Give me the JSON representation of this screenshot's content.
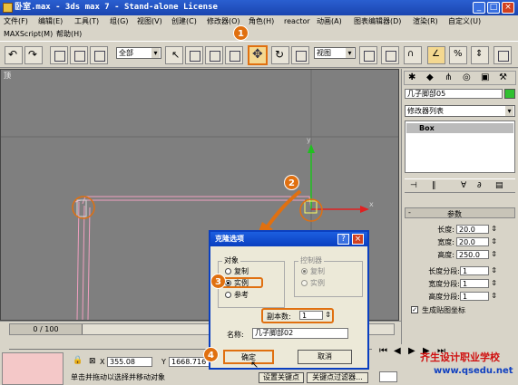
{
  "window": {
    "title": "卧室.max - 3ds max 7 - Stand-alone License"
  },
  "menu": {
    "row1": [
      "文件(F)",
      "编辑(E)",
      "工具(T)",
      "组(G)",
      "视图(V)",
      "创建(C)",
      "修改器(O)",
      "角色(H)",
      "reactor",
      "动画(A)",
      "图表编辑器(D)",
      "渲染(R)",
      "自定义(U)"
    ],
    "row2": [
      "MAXScript(M)",
      "帮助(H)"
    ]
  },
  "toolbar": {
    "selection_filter": "全部",
    "coord_system": "视图"
  },
  "viewport": {
    "label": "顶"
  },
  "right_panel": {
    "object_name": "几子脚部05",
    "modifier_list": "修改器列表",
    "stack_item": "Box",
    "params_title": "参数",
    "params": [
      {
        "label": "长度:",
        "value": "20.0"
      },
      {
        "label": "宽度:",
        "value": "20.0"
      },
      {
        "label": "高度:",
        "value": "250.0"
      },
      {
        "label": "长度分段:",
        "value": "1"
      },
      {
        "label": "宽度分段:",
        "value": "1"
      },
      {
        "label": "高度分段:",
        "value": "1"
      }
    ],
    "gen_mapping": "生成贴图坐标"
  },
  "dialog": {
    "title": "克隆选项",
    "object_group": "对象",
    "object_options": [
      "复制",
      "实例",
      "参考"
    ],
    "controller_group": "控制器",
    "controller_options": [
      "复制",
      "实例"
    ],
    "copies_label": "副本数:",
    "copies_value": "1",
    "name_label": "名称:",
    "name_value": "几子脚部02",
    "ok": "确定",
    "cancel": "取消"
  },
  "status": {
    "timeline": "0 / 100",
    "x_label": "X",
    "x_value": "355.08",
    "y_label": "Y",
    "y_value": "1668.716",
    "prompt": "单击并拖动以选择并移动对象",
    "set_key": "设置关键点",
    "key_filter": "关键点过滤器..."
  },
  "callouts": [
    "1",
    "2",
    "3",
    "4"
  ],
  "watermark": {
    "line1": "齐生设计职业学校",
    "line2": "www.qsedu.net"
  },
  "colors": {
    "accent": "#e07010",
    "title_blue": "#0a3fc0",
    "viewport": "#7f7f7f"
  }
}
